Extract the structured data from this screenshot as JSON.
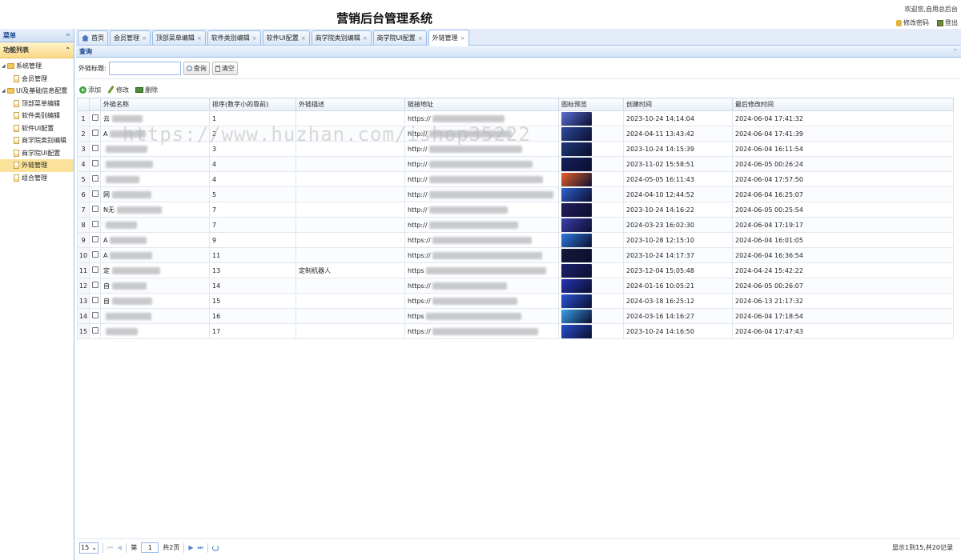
{
  "header": {
    "title": "营销后台管理系统",
    "welcome": "欢迎您,自用总后台",
    "change_password": "修改密码",
    "logout": "登出"
  },
  "sidebar": {
    "menu_label": "菜单",
    "collapse_glyph": "«",
    "panel_title": "功能列表",
    "panel_glyph": "⌃",
    "groups": [
      {
        "label": "系统管理",
        "items": [
          {
            "label": "会员管理",
            "selected": false
          }
        ]
      },
      {
        "label": "UI及基础信息配置",
        "items": [
          {
            "label": "顶部菜单编辑",
            "selected": false
          },
          {
            "label": "软件类别编辑",
            "selected": false
          },
          {
            "label": "软件UI配置",
            "selected": false
          },
          {
            "label": "商学院类别编辑",
            "selected": false
          },
          {
            "label": "商学院UI配置",
            "selected": false
          },
          {
            "label": "外链管理",
            "selected": true
          },
          {
            "label": "组合管理",
            "selected": false
          }
        ]
      }
    ]
  },
  "tabs": [
    {
      "label": "首页",
      "closable": false,
      "active": false
    },
    {
      "label": "会员管理",
      "closable": true,
      "active": false
    },
    {
      "label": "顶部菜单编辑",
      "closable": true,
      "active": false
    },
    {
      "label": "软件类别编辑",
      "closable": true,
      "active": false
    },
    {
      "label": "软件UI配置",
      "closable": true,
      "active": false
    },
    {
      "label": "商学院类别编辑",
      "closable": true,
      "active": false
    },
    {
      "label": "商学院UI配置",
      "closable": true,
      "active": false
    },
    {
      "label": "外链管理",
      "closable": true,
      "active": true
    }
  ],
  "tab_close_glyph": "×",
  "query": {
    "panel_title": "查询",
    "collapse_glyph": "⌃",
    "field_label": "外链标题:",
    "field_value": "",
    "search_button": "查询",
    "clear_button": "清空"
  },
  "toolbar": {
    "add": "添加",
    "edit": "修改",
    "delete": "删除"
  },
  "table": {
    "columns": [
      "外链名称",
      "排序(数字小的靠前)",
      "外链描述",
      "链接地址",
      "图标预览",
      "创建时间",
      "最后修改时间"
    ],
    "rows": [
      {
        "n": "1",
        "name": "云",
        "sort": "1",
        "desc": "",
        "url": "https://",
        "created": "2023-10-24 14:14:04",
        "modified": "2024-06-04 17:41:32",
        "preview_color": "#5b6fd6"
      },
      {
        "n": "2",
        "name": "A",
        "sort": "2",
        "desc": "",
        "url": "http://",
        "created": "2024-04-11 13:43:42",
        "modified": "2024-06-04 17:41:39",
        "preview_color": "#2b4c9c"
      },
      {
        "n": "3",
        "name": "",
        "sort": "3",
        "desc": "",
        "url": "http://",
        "created": "2023-10-24 14:15:39",
        "modified": "2024-06-04 16:11:54",
        "preview_color": "#1d3a7a"
      },
      {
        "n": "4",
        "name": "",
        "sort": "4",
        "desc": "",
        "url": "http://",
        "created": "2023-11-02 15:58:51",
        "modified": "2024-06-05 00:26:24",
        "preview_color": "#13205c"
      },
      {
        "n": "5",
        "name": "",
        "sort": "4",
        "desc": "",
        "url": "http://",
        "created": "2024-05-05 16:11:43",
        "modified": "2024-06-04 17:57:50",
        "preview_color": "#e8602c"
      },
      {
        "n": "6",
        "name": "网",
        "sort": "5",
        "desc": "",
        "url": "http://",
        "created": "2024-04-10 12:44:52",
        "modified": "2024-06-04 16:25:07",
        "preview_color": "#2f62d1"
      },
      {
        "n": "7",
        "name": "N无",
        "sort": "7",
        "desc": "",
        "url": "http://",
        "created": "2023-10-24 14:16:22",
        "modified": "2024-06-05 00:25:54",
        "preview_color": "#241c5c"
      },
      {
        "n": "8",
        "name": "",
        "sort": "7",
        "desc": "",
        "url": "http://",
        "created": "2024-03-23 16:02:30",
        "modified": "2024-06-04 17:19:17",
        "preview_color": "#3a3fae"
      },
      {
        "n": "9",
        "name": "A",
        "sort": "9",
        "desc": "",
        "url": "https://",
        "created": "2023-10-28 12:15:10",
        "modified": "2024-06-04 16:01:05",
        "preview_color": "#2a7be0"
      },
      {
        "n": "10",
        "name": "A",
        "sort": "11",
        "desc": "",
        "url": "https://",
        "created": "2023-10-24 14:17:37",
        "modified": "2024-06-04 16:36:54",
        "preview_color": "#141a3c"
      },
      {
        "n": "11",
        "name": "定",
        "sort": "13",
        "desc": "定制机器人",
        "url": "https",
        "created": "2023-12-04 15:05:48",
        "modified": "2024-04-24 15:42:22",
        "preview_color": "#1c2270"
      },
      {
        "n": "12",
        "name": "自",
        "sort": "14",
        "desc": "",
        "url": "https://",
        "created": "2024-01-16 10:05:21",
        "modified": "2024-06-05 00:26:07",
        "preview_color": "#2434b4"
      },
      {
        "n": "13",
        "name": "自",
        "sort": "15",
        "desc": "",
        "url": "https://",
        "created": "2024-03-18 16:25:12",
        "modified": "2024-06-13 21:17:32",
        "preview_color": "#2b55d8"
      },
      {
        "n": "14",
        "name": "",
        "sort": "16",
        "desc": "",
        "url": "https",
        "created": "2024-03-16 14:16:27",
        "modified": "2024-06-04 17:18:54",
        "preview_color": "#3aa0e8"
      },
      {
        "n": "15",
        "name": "",
        "sort": "17",
        "desc": "",
        "url": "https://",
        "created": "2023-10-24 14:16:50",
        "modified": "2024-06-04 17:47:43",
        "preview_color": "#2a4fd0"
      }
    ]
  },
  "watermark": "https://www.huzhan.com/ishop35222",
  "pager": {
    "page_size": "15",
    "page_label_before": "第",
    "page_value": "1",
    "page_label_after": "共2页",
    "info": "显示1到15,共20记录",
    "first_glyph": "⏮",
    "prev_glyph": "◀",
    "next_glyph": "▶",
    "last_glyph": "⏭",
    "dropdown_glyph": "⌄"
  }
}
